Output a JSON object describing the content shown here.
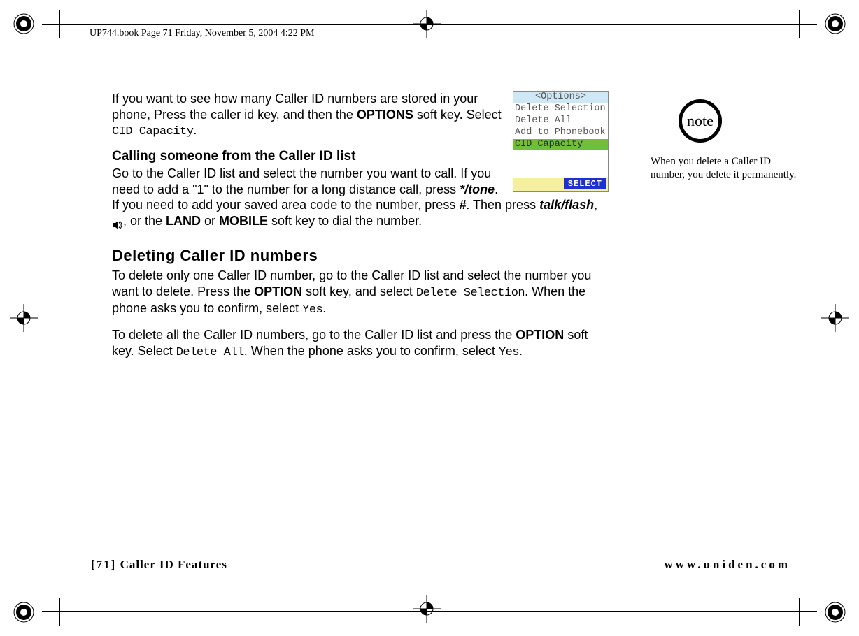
{
  "meta": {
    "header_line": "UP744.book  Page 71  Friday, November 5, 2004  4:22 PM"
  },
  "body": {
    "p1_a": "If you want to see how many Caller ID numbers are stored in your phone, Press the caller id key, and then the ",
    "p1_b_bold": "OPTIONS",
    "p1_c": " soft key. Select ",
    "p1_d_lcd": "CID Capacity",
    "p1_e": ".",
    "h1": "Calling someone from the Caller ID list",
    "p2_a": "Go to the Caller ID list and select the number you want to call. If you need to add a \"1\" to the number for a long distance call, press  ",
    "p2_b_bi": "*/tone",
    "p2_c": ". If you need to add your saved area code to the number, press ",
    "p2_d_bi": "#",
    "p2_e": ". Then press ",
    "p2_f_bi": "talk/flash",
    "p2_g": ", ",
    "p2_h": ", or the ",
    "p2_i_bold": "LAND",
    "p2_j": " or ",
    "p2_k_bold": "MOBILE",
    "p2_l": " soft key to dial the number.",
    "h2": "Deleting Caller ID numbers",
    "p3_a": "To delete only one Caller ID number, go to the Caller ID list and select the number you want to delete. Press the ",
    "p3_b_bold": "OPTION",
    "p3_c": " soft key, and select ",
    "p3_d_lcd": "Delete Selection",
    "p3_e": ". When the phone asks you to confirm, select ",
    "p3_f_lcd": "Yes",
    "p3_g": ".",
    "p4_a": "To delete all the Caller ID numbers, go to the Caller ID list and press the ",
    "p4_b_bold": "OPTION",
    "p4_c": " soft key. Select ",
    "p4_d_lcd": "Delete All",
    "p4_e": ". When the phone asks you to confirm, select ",
    "p4_f_lcd": "Yes",
    "p4_g": "."
  },
  "screen": {
    "title": "<Options>",
    "rows": [
      "Delete Selection",
      "Delete All",
      "Add to Phonebook"
    ],
    "highlight": "CID Capacity",
    "select": "SELECT"
  },
  "note": {
    "badge": "note",
    "text": "When you delete a Caller ID number, you delete it permanently."
  },
  "footer": {
    "page_num": "[71]",
    "section": "Caller ID Features",
    "url": "www.uniden.com"
  }
}
